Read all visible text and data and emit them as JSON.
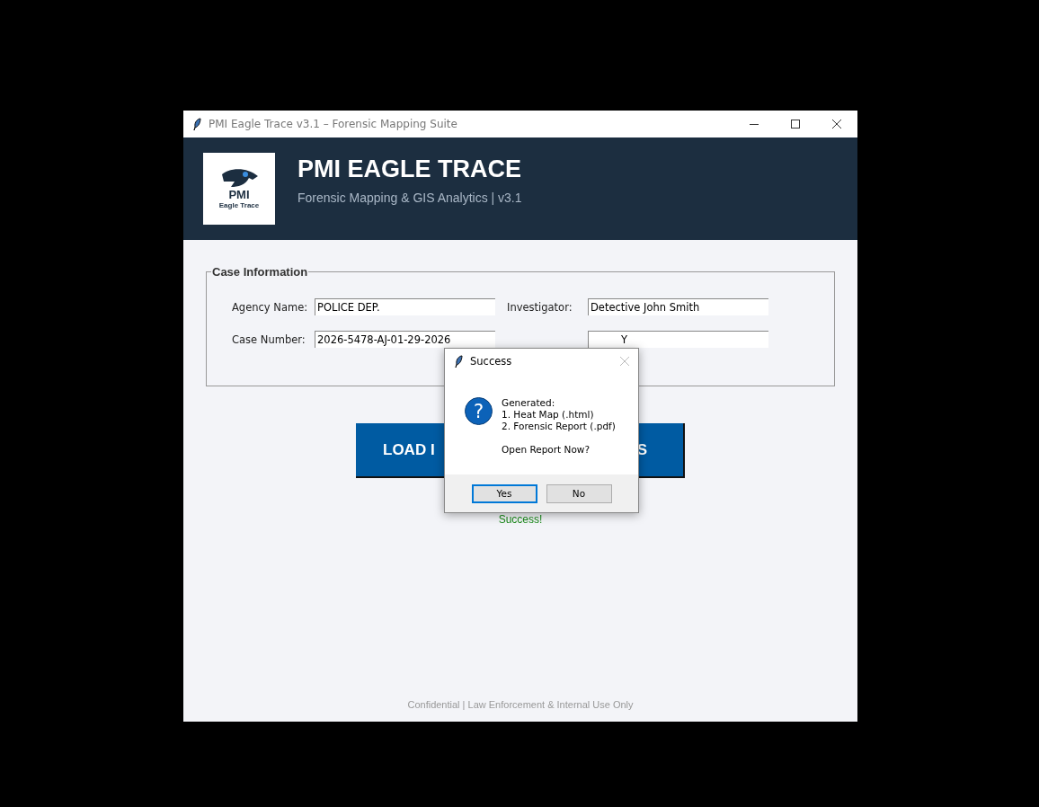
{
  "window": {
    "title": "PMI Eagle Trace v3.1 – Forensic Mapping Suite"
  },
  "header": {
    "logo": {
      "initials": "PMI",
      "name": "Eagle Trace"
    },
    "title": "PMI EAGLE TRACE",
    "subtitle": "Forensic Mapping & GIS Analytics | v3.1"
  },
  "case_information": {
    "legend": "Case Information",
    "fields": [
      {
        "label": "Agency Name:",
        "value": "POLICE DEP."
      },
      {
        "label": "Investigator:",
        "value": "Detective John Smith"
      },
      {
        "label": "Case Number:",
        "value": "2026-5478-AJ-01-29-2026"
      },
      {
        "value": "Y"
      }
    ]
  },
  "load_button": {
    "label_left": "LOAD I",
    "label_right": "S"
  },
  "status": "Success!",
  "footer": "Confidential | Law Enforcement & Internal Use Only",
  "dialog": {
    "title": "Success",
    "icon": "?",
    "message": [
      "Generated:",
      "1. Heat Map (.html)",
      "2. Forensic Report (.pdf)"
    ],
    "prompt": "Open Report Now?",
    "buttons": [
      {
        "label": "Yes",
        "selected": true
      },
      {
        "label": "No",
        "selected": false
      }
    ]
  }
}
